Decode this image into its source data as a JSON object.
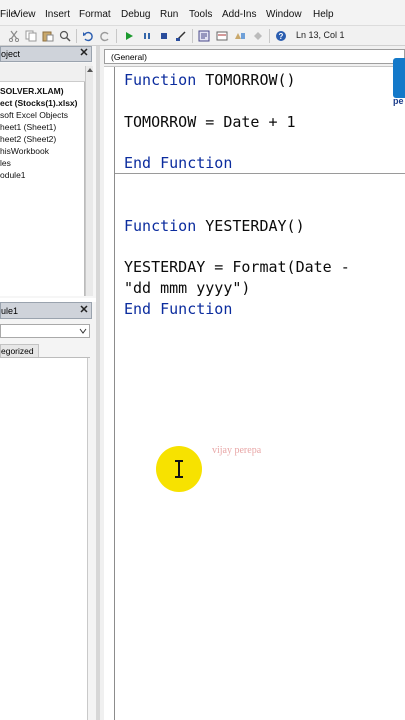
{
  "menu": [
    "File",
    "View",
    "Insert",
    "Format",
    "Debug",
    "Run",
    "Tools",
    "Add-Ins",
    "Window",
    "Help"
  ],
  "toolbar": {
    "position": "Ln 13, Col 1"
  },
  "project": {
    "title": "oject",
    "items": [
      {
        "label": "SOLVER.XLAM)",
        "bold": true
      },
      {
        "label": "ect (Stocks(1).xlsx)",
        "bold": true
      },
      {
        "label": "soft Excel Objects",
        "bold": false
      },
      {
        "label": "heet1 (Sheet1)",
        "bold": false
      },
      {
        "label": "heet2 (Sheet2)",
        "bold": false
      },
      {
        "label": "hisWorkbook",
        "bold": false
      },
      {
        "label": "les",
        "bold": false
      },
      {
        "label": "odule1",
        "bold": false
      }
    ]
  },
  "properties": {
    "title": "ule1",
    "combo_value": "",
    "tab": "egorized"
  },
  "code": {
    "object_combo": "(General)",
    "lines": [
      {
        "kw": "Function",
        "rest": " TOMORROW()"
      },
      {
        "kw": "",
        "rest": "TOMORROW = Date + 1"
      },
      {
        "kw": "End Function",
        "rest": ""
      },
      {
        "kw": "Function",
        "rest": " YESTERDAY()"
      },
      {
        "kw": "",
        "rest": "YESTERDAY = Format(Date -"
      },
      {
        "kw": "",
        "rest": "\"dd mmm yyyy\")"
      },
      {
        "kw": "End Function",
        "rest": ""
      }
    ]
  },
  "watermark": "vijay perepa",
  "logo": {
    "text": "pe",
    "color": "#1479c9"
  },
  "colors": {
    "keyword": "#0b2c9e",
    "cursor_highlight": "#f7e200"
  },
  "icons": [
    "close-icon",
    "ibeam-cursor-icon",
    "run-icon",
    "pause-icon",
    "stop-icon",
    "design-mode-icon",
    "help-icon"
  ]
}
